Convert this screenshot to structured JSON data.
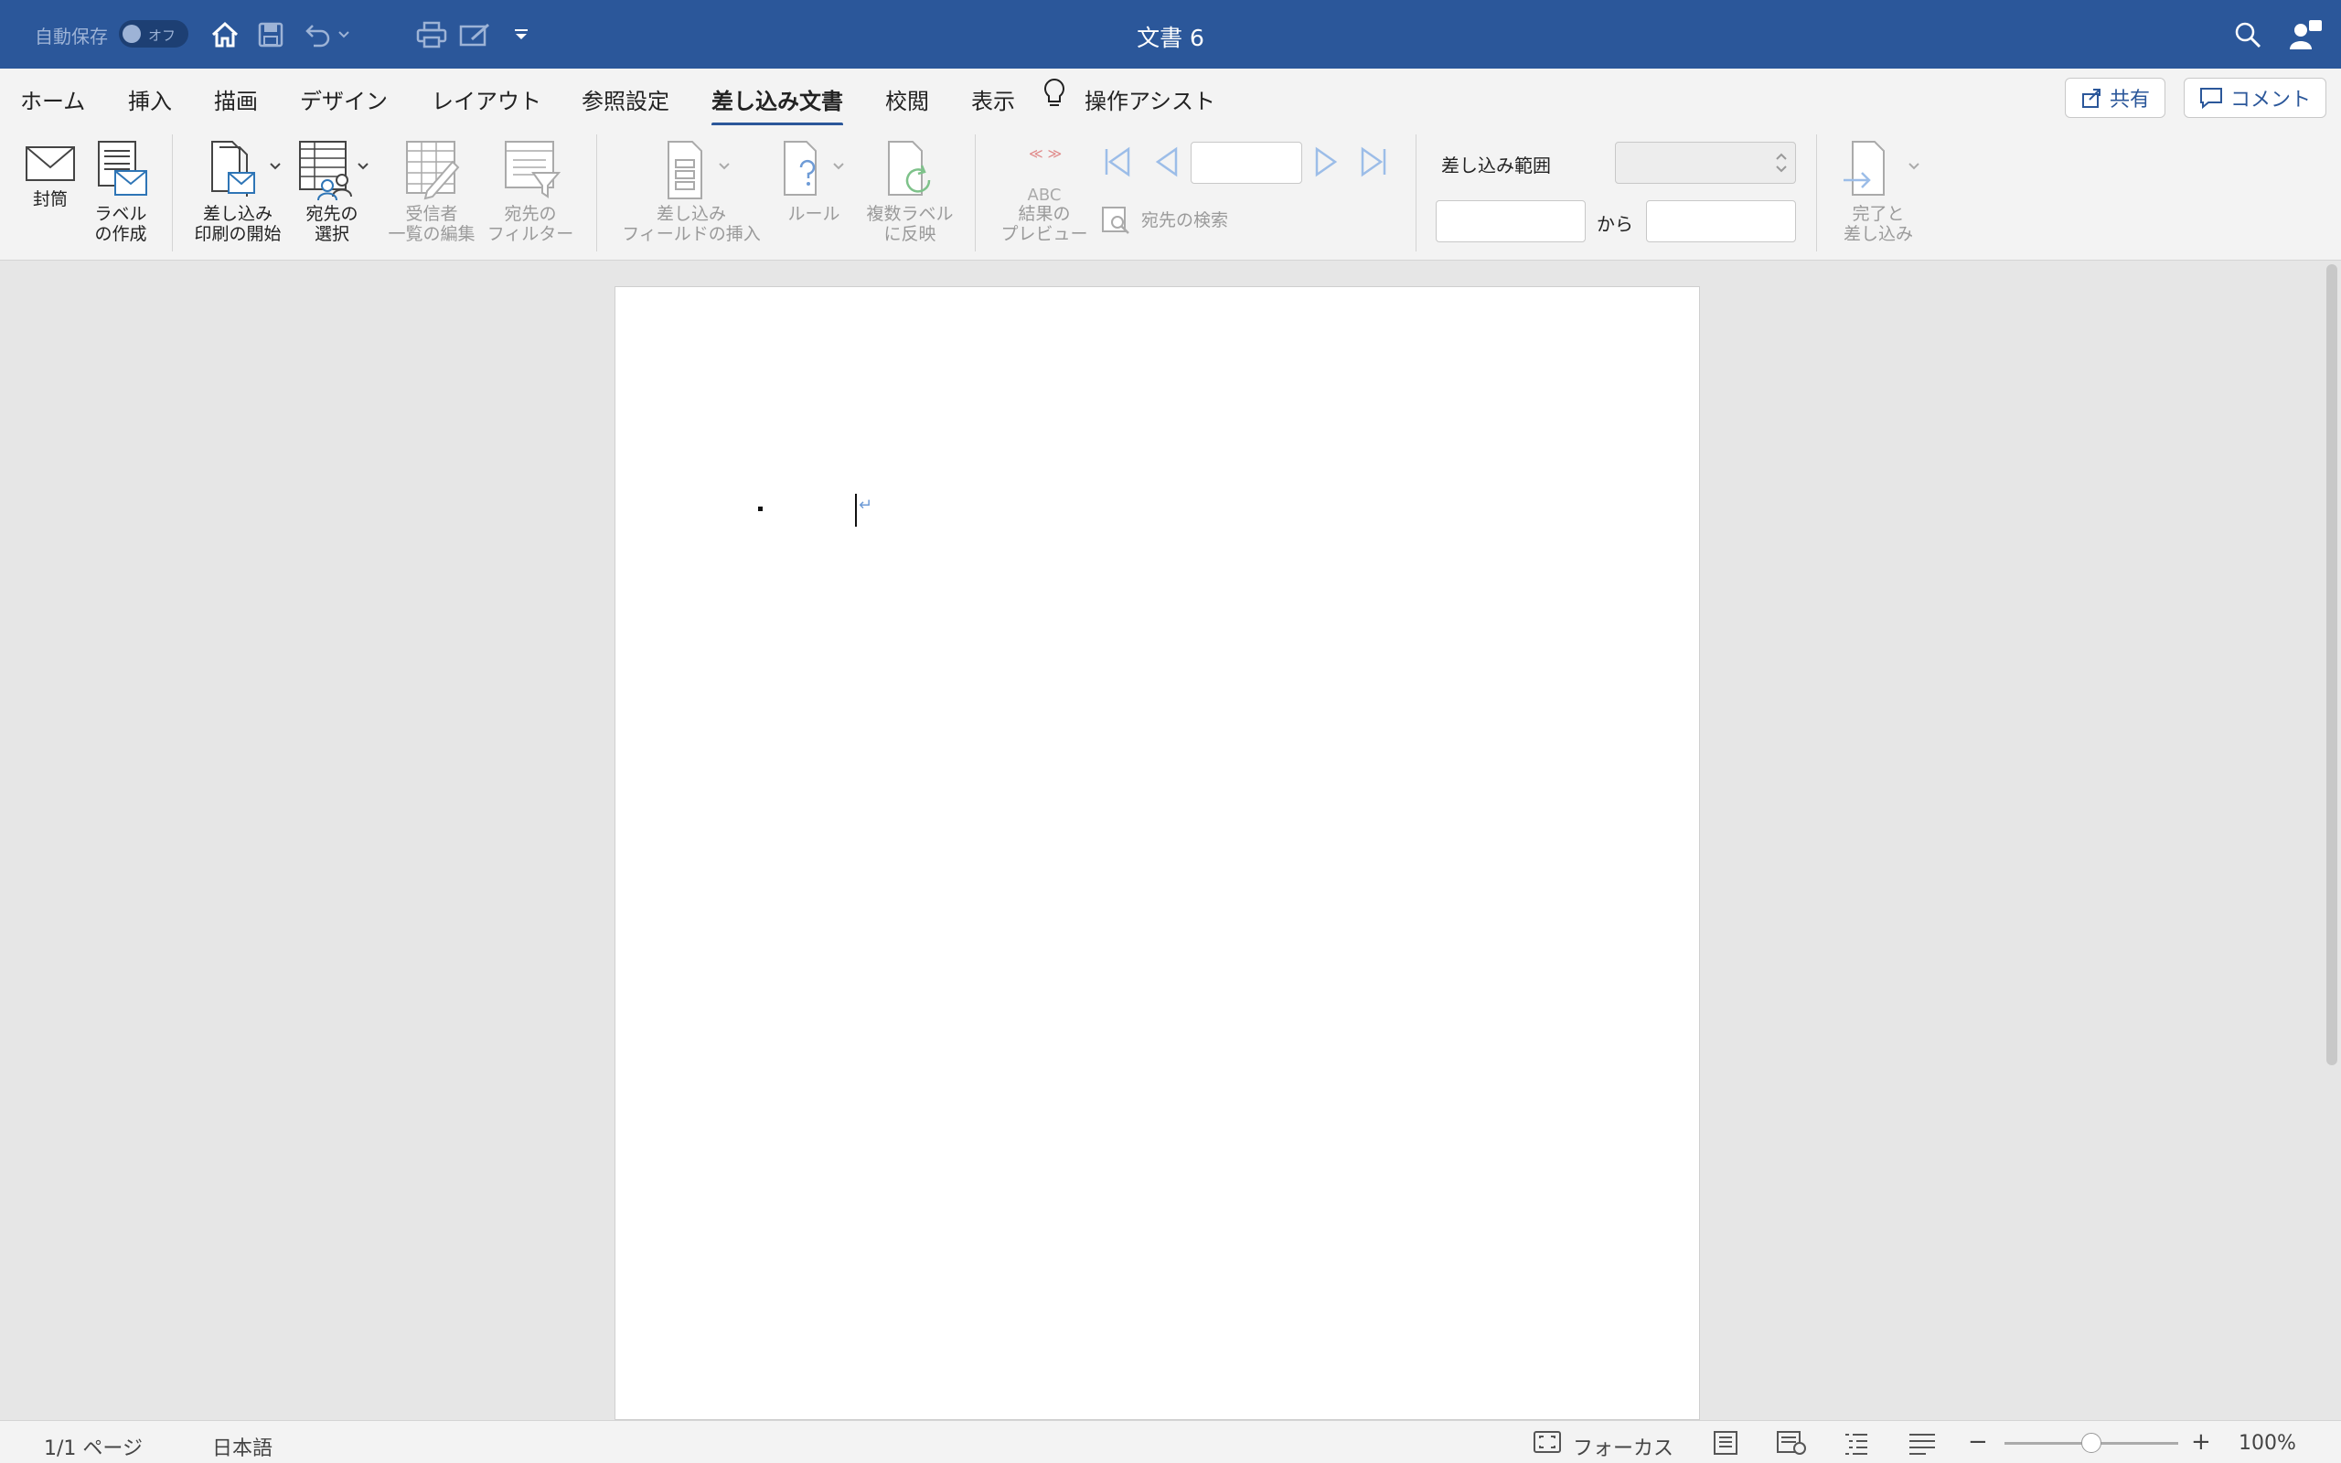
{
  "titlebar": {
    "autosave_label": "自動保存",
    "autosave_state": "オフ",
    "doc_title": "文書 6"
  },
  "tabs": [
    {
      "label": "ホーム"
    },
    {
      "label": "挿入"
    },
    {
      "label": "描画"
    },
    {
      "label": "デザイン"
    },
    {
      "label": "レイアウト"
    },
    {
      "label": "参照設定"
    },
    {
      "label": "差し込み文書",
      "active": true
    },
    {
      "label": "校閲"
    },
    {
      "label": "表示"
    }
  ],
  "assist_label": "操作アシスト",
  "share_label": "共有",
  "comment_label": "コメント",
  "ribbon": {
    "envelope": "封筒",
    "labels": "ラベル\nの作成",
    "start_merge": "差し込み\n印刷の開始",
    "select_recipients": "宛先の\n選択",
    "edit_list": "受信者\n一覧の編集",
    "filter": "宛先の\nフィルター",
    "insert_field": "差し込み\nフィールドの挿入",
    "rules": "ルール",
    "update_labels": "複数ラベル\nに反映",
    "preview": "結果の\nプレビュー",
    "preview_icon_text": "ABC",
    "find_recipient": "宛先の検索",
    "merge_range": "差し込み範囲",
    "from": "から",
    "finish_merge": "完了と\n差し込み"
  },
  "status": {
    "page": "1/1 ページ",
    "language": "日本語",
    "focus": "フォーカス",
    "zoom": "100%",
    "zoom_fraction": 0.5
  },
  "colors": {
    "title_bar": "#2b579a",
    "accent": "#2b579a"
  }
}
